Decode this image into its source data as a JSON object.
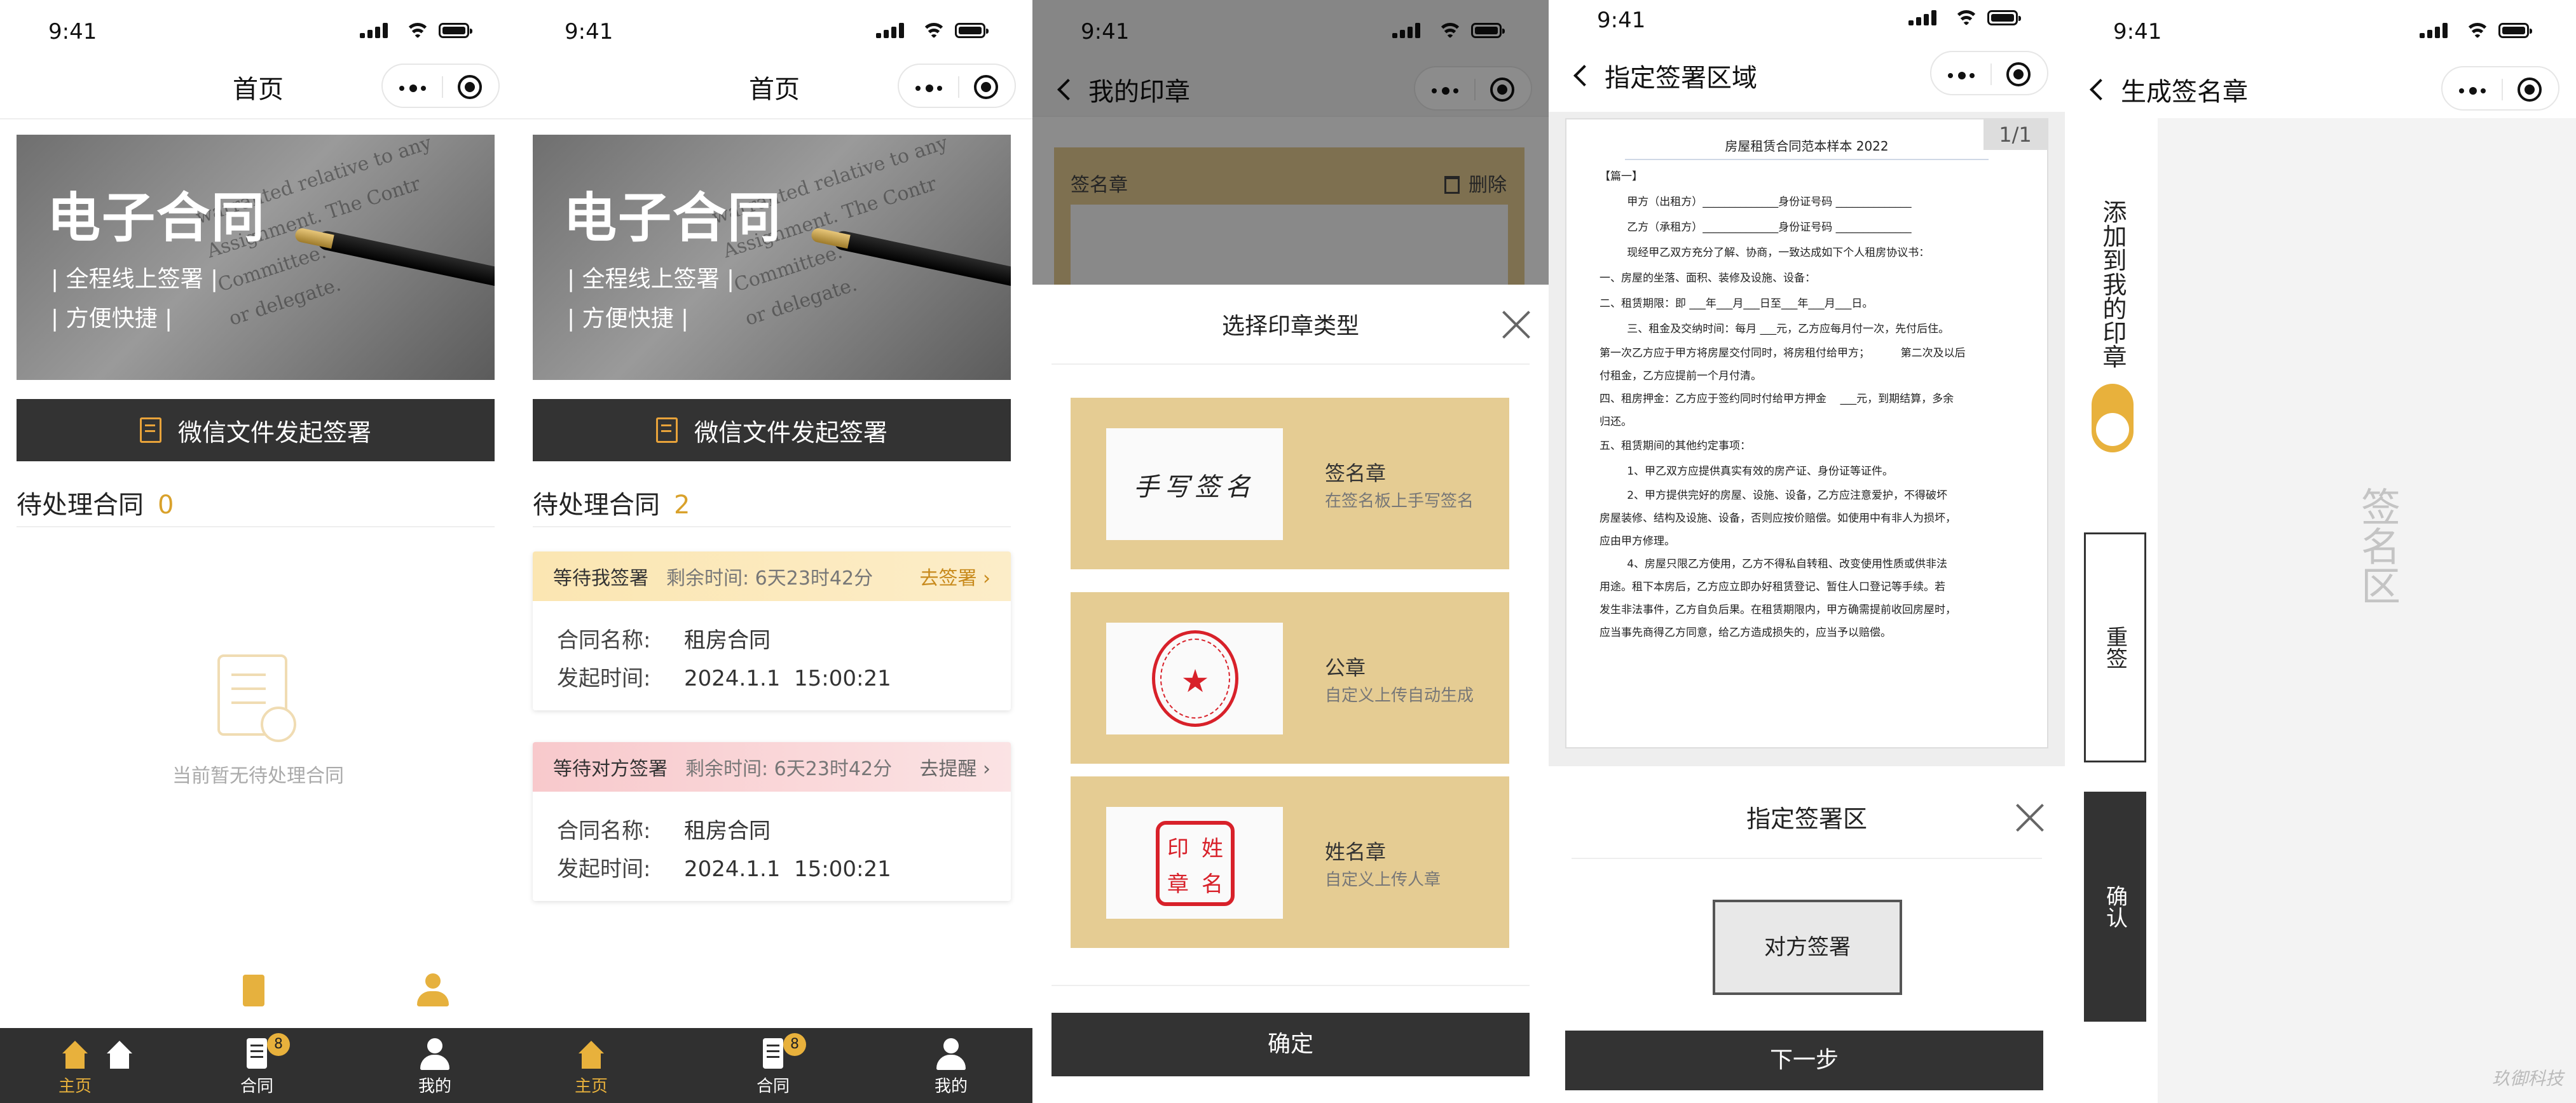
{
  "status_bar": {
    "time": "9:41"
  },
  "screen1": {
    "nav_title": "首页",
    "banner": {
      "title": "电子合同",
      "line1": "| 全程线上签署 |",
      "line2": "| 方便快捷 |",
      "photo_text": "warranted relative to any\nAssignment. The Contr\nCommittee.\nor delegate."
    },
    "wechat_button": "微信文件发起签署",
    "pending": {
      "label": "待处理合同",
      "count": "0"
    },
    "empty_text": "当前暂无待处理合同",
    "tabs": [
      {
        "label": "主页"
      },
      {
        "label": "合同",
        "badge": "8"
      },
      {
        "label": "我的"
      }
    ]
  },
  "screen2": {
    "nav_title": "首页",
    "banner": {
      "title": "电子合同",
      "line1": "| 全程线上签署 |",
      "line2": "| 方便快捷 |"
    },
    "wechat_button": "微信文件发起签署",
    "pending": {
      "label": "待处理合同",
      "count": "2"
    },
    "cards": [
      {
        "status": "等待我签署",
        "remaining": "剩余时间: 6天23时42分",
        "action": "去签署",
        "name_key": "合同名称:",
        "name": "租房合同",
        "time_key": "发起时间:",
        "time": "2024.1.1  15:00:21",
        "header_color": "#fbe7b5"
      },
      {
        "status": "等待对方签署",
        "remaining": "剩余时间: 6天23时42分",
        "action": "去提醒",
        "name_key": "合同名称:",
        "name": "租房合同",
        "time_key": "发起时间:",
        "time": "2024.1.1  15:00:21",
        "header_color": "#f9d4d6"
      }
    ],
    "tabs": [
      {
        "label": "主页"
      },
      {
        "label": "合同",
        "badge": "8"
      },
      {
        "label": "我的"
      }
    ]
  },
  "screen3": {
    "nav_title": "我的印章",
    "bg_card": {
      "title": "签名章",
      "delete": "删除"
    },
    "sheet_title": "选择印章类型",
    "options": [
      {
        "name": "签名章",
        "desc": "在签名板上手写签名",
        "sample": "手写签名"
      },
      {
        "name": "公章",
        "desc": "自定义上传自动生成",
        "sample": "★"
      },
      {
        "name": "姓名章",
        "desc": "自定义上传人章",
        "sample": [
          "印",
          "姓",
          "章",
          "名"
        ]
      }
    ],
    "confirm": "确定"
  },
  "screen4": {
    "nav_title": "指定签署区域",
    "page_indicator": "1/1",
    "doc": {
      "title": "房屋租赁合同范本样本  2022",
      "lines": [
        "【篇一】",
        "        甲方（出租方）______________身份证号码 ______________",
        "        乙方（承租方）______________身份证号码 ______________",
        "        现经甲乙双方充分了解、协商，一致达成如下个人租房协议书：",
        "一、房屋的坐落、面积、装修及设施、设备：",
        "二、租赁期限：即 ___年___月___日至___年___月___日。",
        "        三、租金及交纳时间：每月 ___元，乙方应每月付一次，先付后住。",
        "第一次乙方应于甲方将房屋交付同时，将房租付给甲方；         第二次及以后",
        "付租金，乙方应提前一个月付清。",
        "四、租房押金：乙方应于签约同时付给甲方押金    ___元，到期结算，多余",
        "归还。",
        "五、租赁期间的其他约定事项：",
        "        1、甲乙双方应提供真实有效的房产证、身份证等证件。",
        "        2、甲方提供完好的房屋、设施、设备，乙方应注意爱护，不得破坏",
        "房屋装修、结构及设施、设备，否则应按价赔偿。如使用中有非人为损坏，",
        "应由甲方修理。",
        "        4、房屋只限乙方使用，乙方不得私自转租、改变使用性质或供非法",
        "用途。租下本房后，乙方应立即办好租赁登记、暂住人口登记等手续。若",
        "发生非法事件，乙方自负后果。在租赁期限内，甲方确需提前收回房屋时，",
        "应当事先商得乙方同意，给乙方造成损失的，应当予以赔偿。"
      ]
    },
    "panel_title": "指定签署区",
    "counterparty_btn": "对方签署",
    "next": "下一步"
  },
  "screen5": {
    "nav_title": "生成签名章",
    "add_to_mine": "添加到我的印章",
    "resign": "重签",
    "confirm": "确认",
    "area_label": "签名区",
    "watermark": "玖御科技"
  },
  "colors": {
    "accent": "#e8b13c",
    "dark": "#333333",
    "stamp_bg": "#e5cc93",
    "seal_red": "#d8212a"
  }
}
